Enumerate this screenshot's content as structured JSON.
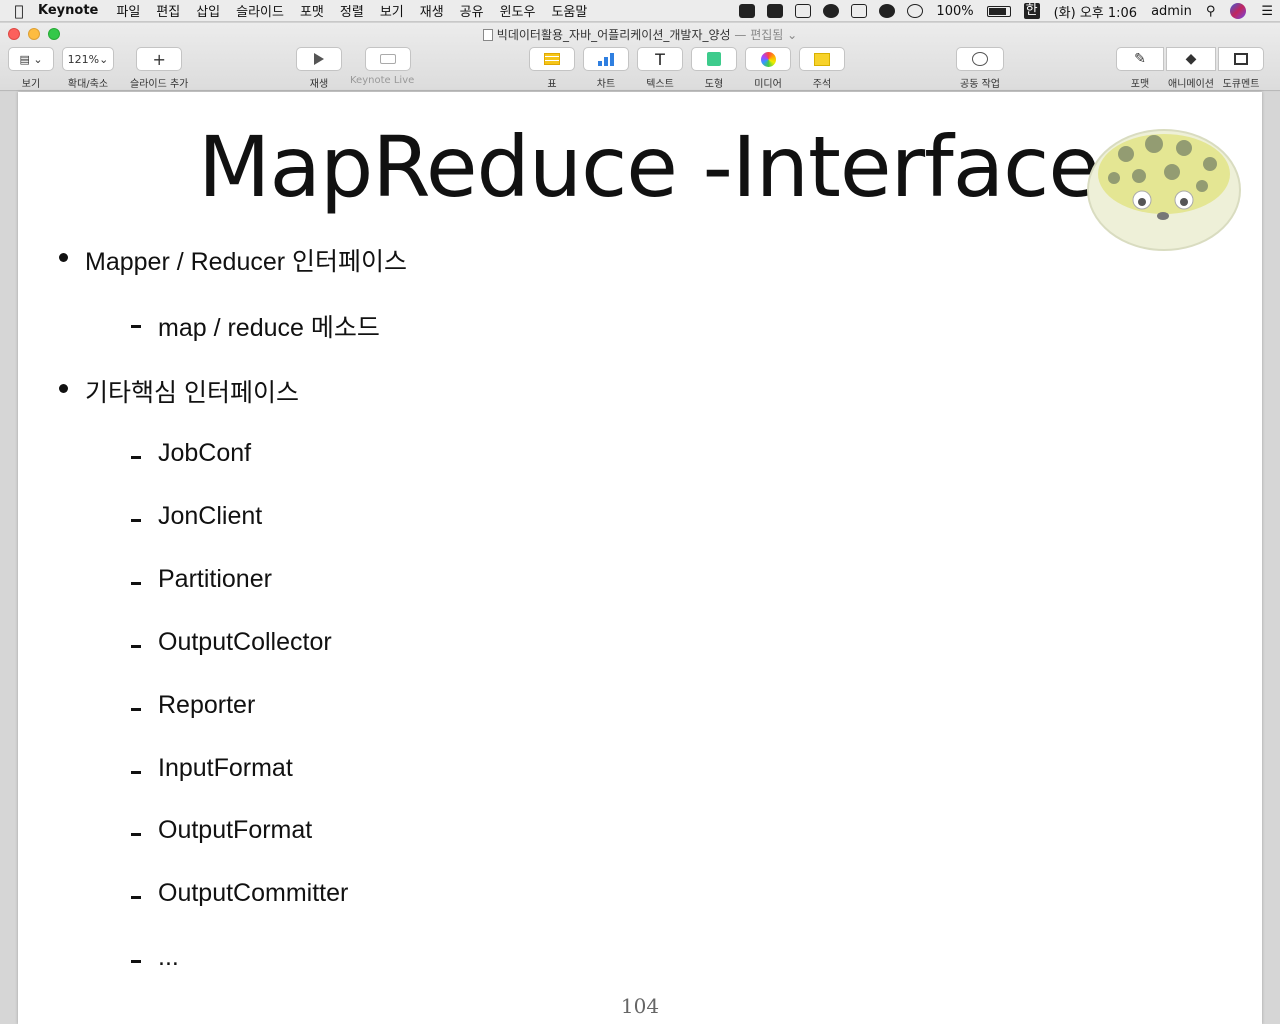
{
  "menubar": {
    "app_name": "Keynote",
    "menus": [
      "파일",
      "편집",
      "삽입",
      "슬라이드",
      "포맷",
      "정렬",
      "보기",
      "재생",
      "공유",
      "윈도우",
      "도움말"
    ],
    "battery": "100%",
    "input_source": "한",
    "clock": "(화) 오후 1:06",
    "user": "admin"
  },
  "window": {
    "title": "빅데이터활용_자바_어플리케이션_개발자_양성",
    "status": "— 편집됨 ⌄"
  },
  "toolbar": {
    "view": "보기",
    "zoom_value": "121%",
    "zoom": "확대/축소",
    "add_slide": "슬라이드 추가",
    "play": "재생",
    "keynote_live": "Keynote Live",
    "table": "표",
    "chart": "차트",
    "text": "텍스트",
    "shape": "도형",
    "media": "미디어",
    "comment": "주석",
    "collaborate": "공동 작업",
    "format": "포맷",
    "animate": "애니메이션",
    "document": "도큐멘트"
  },
  "slide": {
    "title": "MapReduce -Interfaces",
    "bullets": [
      {
        "text": "Mapper / Reducer 인터페이스",
        "level": 1
      },
      {
        "text": "map / reduce 메소드",
        "level": 2
      },
      {
        "text": "기타핵심 인터페이스",
        "level": 1
      },
      {
        "text": "JobConf",
        "level": 2
      },
      {
        "text": "JonClient",
        "level": 2
      },
      {
        "text": "Partitioner",
        "level": 2
      },
      {
        "text": "OutputCollector",
        "level": 2
      },
      {
        "text": "Reporter",
        "level": 2
      },
      {
        "text": "InputFormat",
        "level": 2
      },
      {
        "text": "OutputFormat",
        "level": 2
      },
      {
        "text": "OutputCommitter",
        "level": 2
      },
      {
        "text": "...",
        "level": 2
      }
    ],
    "page_number": "104"
  }
}
